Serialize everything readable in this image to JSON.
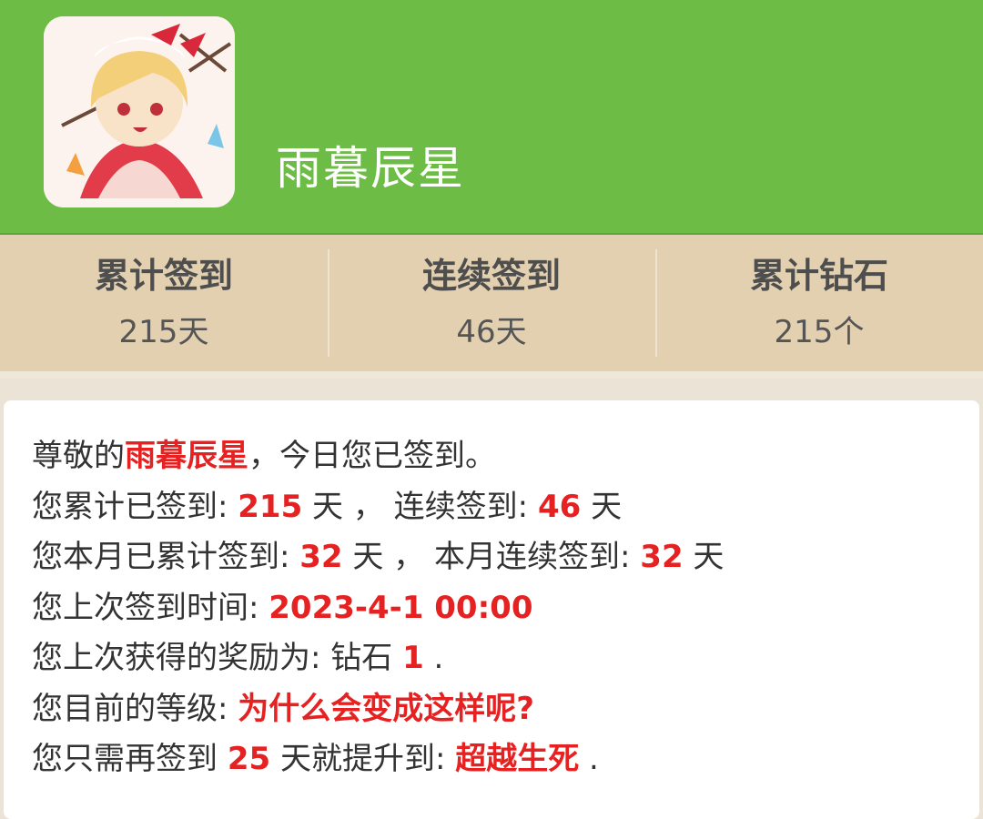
{
  "header": {
    "username": "雨暮辰星",
    "background_color": "#6cbc45",
    "avatar_icon": "anime-character-avatar"
  },
  "stats": [
    {
      "title": "累计签到",
      "value": "215天"
    },
    {
      "title": "连续签到",
      "value": "46天"
    },
    {
      "title": "累计钻石",
      "value": "215个"
    }
  ],
  "info": {
    "accent_color": "#e52121",
    "line1": {
      "prefix": "尊敬的",
      "name": "雨暮辰星",
      "suffix": "，今日您已签到。"
    },
    "line2": {
      "label1": "您累计已签到: ",
      "total_days": "215",
      "sep": " 天 ， 连续签到: ",
      "streak_days": "46",
      "unit": " 天"
    },
    "line3": {
      "label1": "您本月已累计签到: ",
      "month_total": "32",
      "sep": " 天 ， 本月连续签到: ",
      "month_streak": "32",
      "unit": " 天"
    },
    "line4": {
      "label": "您上次签到时间: ",
      "time": "2023-4-1 00:00"
    },
    "line5": {
      "label": "您上次获得的奖励为: 钻石 ",
      "amount": "1",
      "end": " ."
    },
    "line6": {
      "label": "您目前的等级: ",
      "level": "为什么会变成这样呢?"
    },
    "line7": {
      "label1": "您只需再签到 ",
      "days": "25",
      "label2": " 天就提升到: ",
      "next_level": "超越生死",
      "end": " ."
    }
  }
}
